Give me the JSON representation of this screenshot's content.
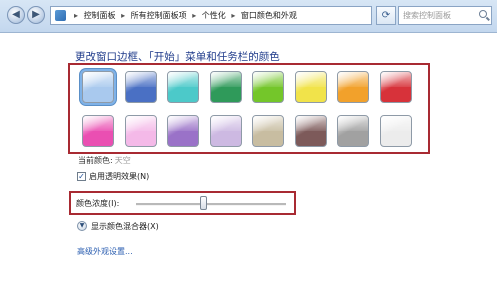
{
  "address_bar": {
    "breadcrumbs": [
      "控制面板",
      "所有控制面板项",
      "个性化",
      "窗口颜色和外观"
    ]
  },
  "search": {
    "placeholder": "搜索控制面板"
  },
  "main": {
    "title": "更改窗口边框、「开始」菜单和任务栏的颜色",
    "swatches": [
      {
        "name": "sky",
        "color": "#a9c9ee"
      },
      {
        "name": "twilight",
        "color": "#4a70c4"
      },
      {
        "name": "sea",
        "color": "#4cc9c9"
      },
      {
        "name": "leaf",
        "color": "#2f9a5a"
      },
      {
        "name": "lime",
        "color": "#74c62a"
      },
      {
        "name": "sun",
        "color": "#f1e34a"
      },
      {
        "name": "pumpkin",
        "color": "#f2a12b"
      },
      {
        "name": "ruby",
        "color": "#d7323a"
      },
      {
        "name": "fuchsia",
        "color": "#ea4fb2"
      },
      {
        "name": "blush",
        "color": "#f4b9e8"
      },
      {
        "name": "violet",
        "color": "#9a72c8"
      },
      {
        "name": "lavender",
        "color": "#cdb9e2"
      },
      {
        "name": "taupe",
        "color": "#c8bda1"
      },
      {
        "name": "chocolate",
        "color": "#7d5a5a"
      },
      {
        "name": "slate",
        "color": "#a1a1a1"
      },
      {
        "name": "frost",
        "color": "#ececec"
      }
    ],
    "selected_swatch_index": 0,
    "current_color_label": "当前颜色:",
    "current_color_value": "天空",
    "transparency_label": "启用透明效果(N)",
    "transparency_checked": true,
    "intensity_label": "颜色浓度(I):",
    "intensity_level_fraction": 0.45,
    "color_mixer_label": "显示颜色混合器(X)",
    "advanced_link": "高级外观设置..."
  },
  "icons": {
    "back": "back-arrow-icon",
    "forward": "forward-arrow-icon",
    "control_panel": "control-panel-icon",
    "refresh": "refresh-icon",
    "search": "search-icon",
    "expand": "chevron-down-icon"
  }
}
